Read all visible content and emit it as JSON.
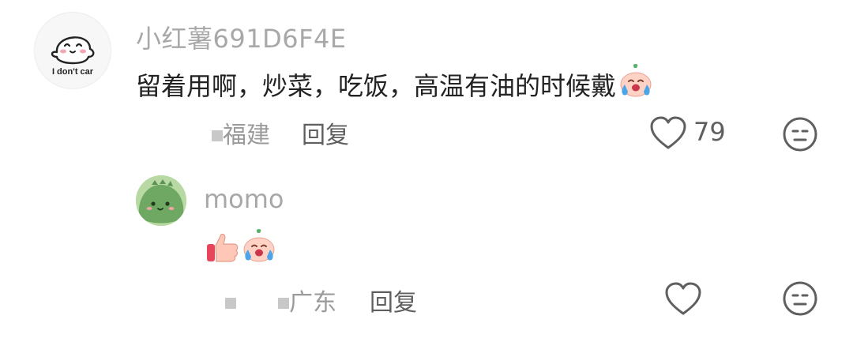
{
  "comments": [
    {
      "avatar": {
        "icon": "smiling-bun-avatar",
        "caption": "I don't car"
      },
      "username": "小红薯691D6F4E",
      "text": "留着用啊，炒菜，吃饭，高温有油的时候戴",
      "emojis": [
        "crying-bun-emoji"
      ],
      "location": "福建",
      "reply_label": "回复",
      "like_count": "79",
      "icons": {
        "like": "heart-outline-icon",
        "react": "meh-face-icon"
      }
    },
    {
      "avatar": {
        "icon": "green-dino-avatar"
      },
      "username": "momo",
      "emojis": [
        "thumbs-up-emoji",
        "crying-bun-emoji"
      ],
      "location": "广东",
      "reply_label": "回复",
      "like_count": "",
      "icons": {
        "like": "heart-outline-icon",
        "react": "meh-face-icon"
      }
    }
  ],
  "colors": {
    "username": "#a8a8a8",
    "body_text": "#222222",
    "meta_text": "#9b9b9b",
    "action_text": "#5f5f5f"
  }
}
